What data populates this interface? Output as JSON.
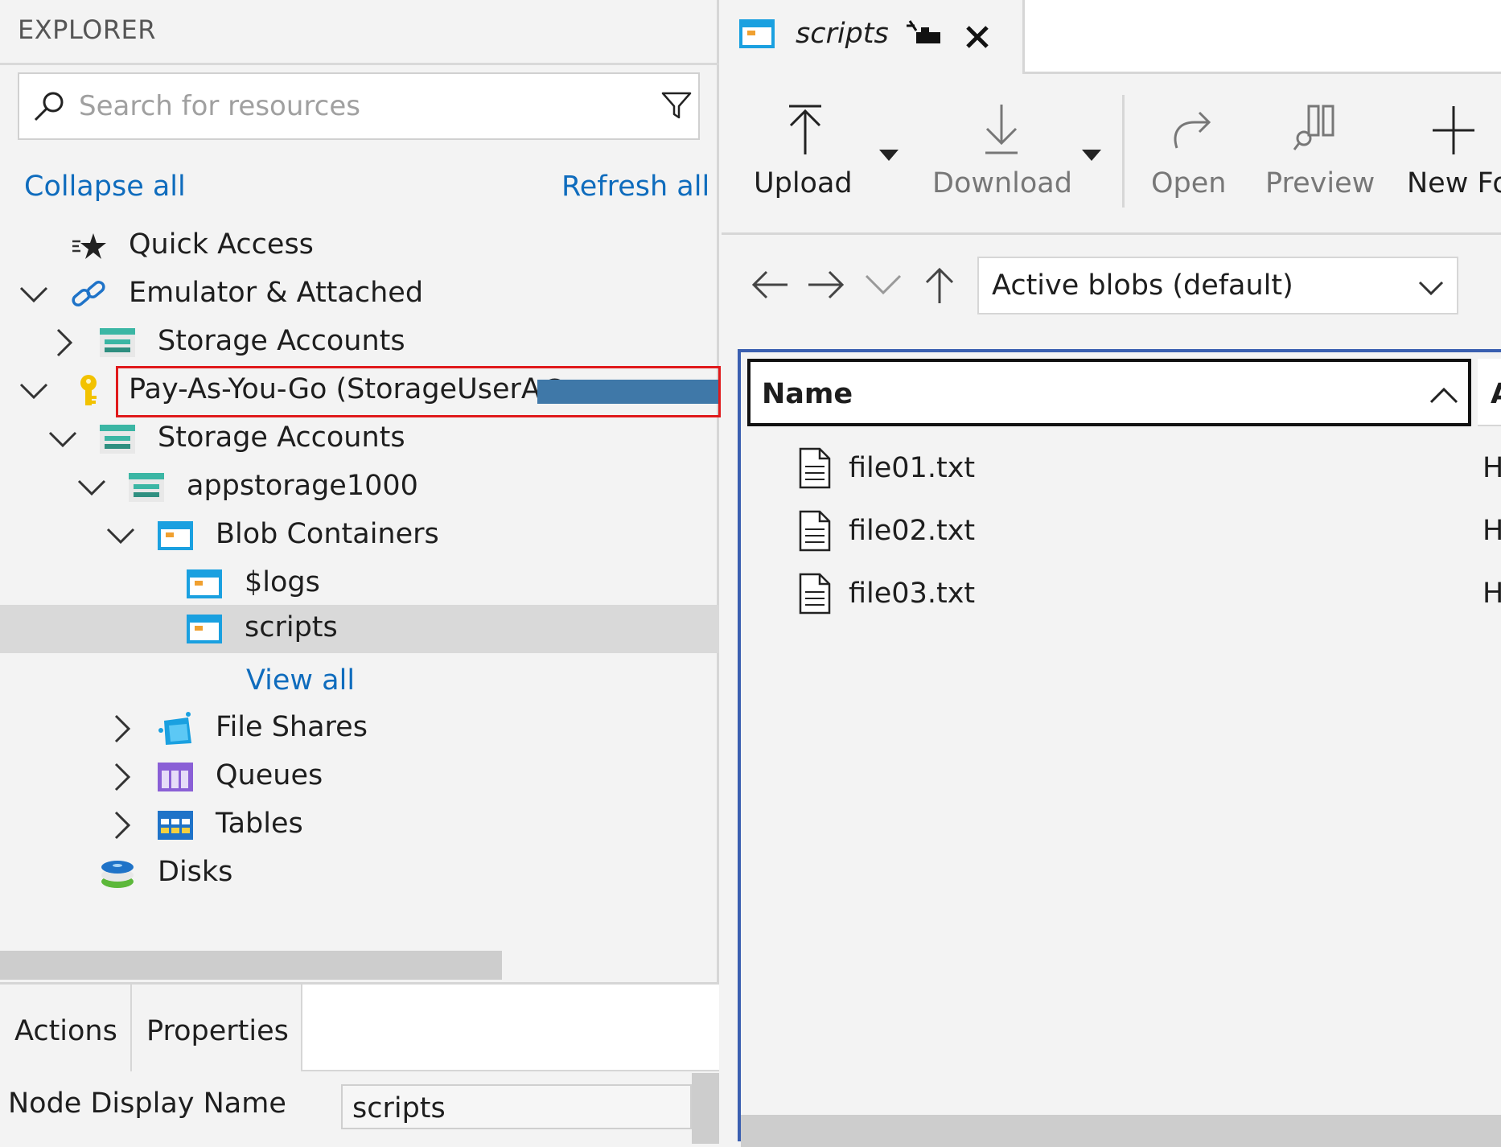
{
  "explorer": {
    "title": "EXPLORER",
    "search_placeholder": "Search for resources",
    "collapse_all": "Collapse all",
    "refresh_all": "Refresh all",
    "tree": [
      {
        "label": "Quick Access",
        "icon": "quick-access-icon"
      },
      {
        "label": "Emulator & Attached",
        "icon": "link-icon",
        "expanded": true
      },
      {
        "label": "Storage Accounts",
        "icon": "storage-account-icon",
        "expanded": false
      },
      {
        "label": "Pay-As-You-Go (StorageUserA@",
        "icon": "key-icon",
        "expanded": true
      },
      {
        "label": "Storage Accounts",
        "icon": "storage-account-icon",
        "expanded": true
      },
      {
        "label": "appstorage1000",
        "icon": "storage-account-icon",
        "expanded": true
      },
      {
        "label": "Blob Containers",
        "icon": "blob-container-icon",
        "expanded": true
      },
      {
        "label": "$logs",
        "icon": "blob-container-icon"
      },
      {
        "label": "scripts",
        "icon": "blob-container-icon",
        "selected": true
      },
      {
        "label": "View all",
        "icon": ""
      },
      {
        "label": "File Shares",
        "icon": "file-share-icon",
        "expanded": false
      },
      {
        "label": "Queues",
        "icon": "queue-icon",
        "expanded": false
      },
      {
        "label": "Tables",
        "icon": "table-icon",
        "expanded": false
      },
      {
        "label": "Disks",
        "icon": "disk-icon"
      }
    ]
  },
  "bottom_panel": {
    "tabs": [
      "Actions",
      "Properties"
    ],
    "property_label": "Node Display Name",
    "property_value": "scripts"
  },
  "editor": {
    "tab_label": "scripts",
    "toolbar": {
      "upload": "Upload",
      "download": "Download",
      "open": "Open",
      "preview": "Preview",
      "new_folder": "New Fo"
    },
    "blob_filter": "Active blobs (default)",
    "grid": {
      "col_name": "Name",
      "col_next": "A",
      "files": [
        {
          "name": "file01.txt",
          "col2": "H"
        },
        {
          "name": "file02.txt",
          "col2": "H"
        },
        {
          "name": "file03.txt",
          "col2": "H"
        }
      ]
    }
  },
  "colors": {
    "link": "#0f6cbd",
    "highlight": "#e0191b",
    "selection": "#d9d9d9",
    "focus": "#3a5fb0"
  }
}
